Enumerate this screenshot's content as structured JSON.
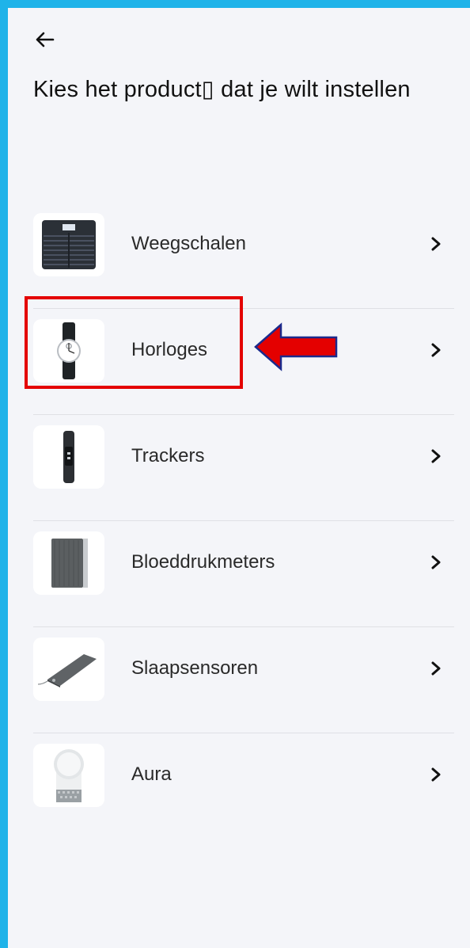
{
  "header": {
    "title": "Kies het product▯ dat je wilt instellen",
    "back_icon": "arrow-left-icon"
  },
  "products": [
    {
      "key": "scales",
      "label": "Weegschalen",
      "icon": "smart-scale-icon"
    },
    {
      "key": "watches",
      "label": "Horloges",
      "icon": "hybrid-watch-icon"
    },
    {
      "key": "trackers",
      "label": "Trackers",
      "icon": "activity-tracker-icon"
    },
    {
      "key": "bpm",
      "label": "Bloeddrukmeters",
      "icon": "blood-pressure-monitor-icon"
    },
    {
      "key": "sleep",
      "label": "Slaapsensoren",
      "icon": "sleep-sensor-icon"
    },
    {
      "key": "aura",
      "label": "Aura",
      "icon": "aura-device-icon"
    }
  ],
  "annotation": {
    "highlight_color": "#e40000",
    "arrow_fill": "#e40000",
    "arrow_stroke": "#1b2a8c"
  },
  "colors": {
    "frame": "#1fb3e9",
    "background": "#f4f5f9"
  }
}
